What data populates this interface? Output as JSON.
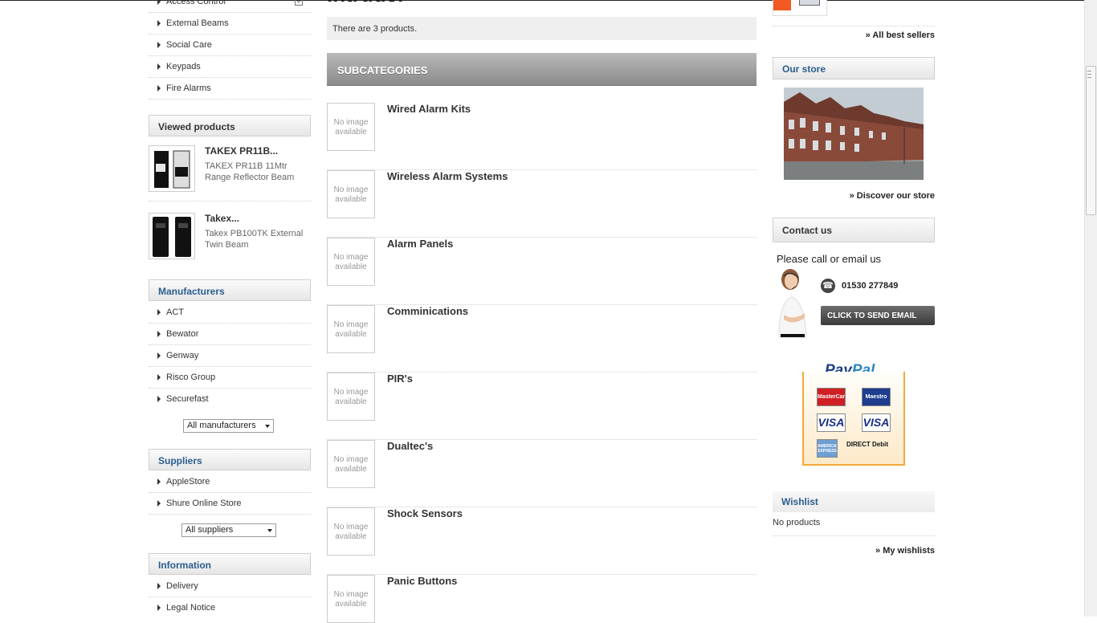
{
  "left": {
    "categories": [
      {
        "label": "Access Control"
      },
      {
        "label": "External Beams"
      },
      {
        "label": "Social Care"
      },
      {
        "label": "Keypads"
      },
      {
        "label": "Fire Alarms"
      }
    ],
    "viewed": {
      "title": "Viewed products",
      "items": [
        {
          "name": "TAKEX PR11B...",
          "desc": "TAKEX PR11B  11Mtr Range Reflector Beam"
        },
        {
          "name": "Takex...",
          "desc": "Takex PB100TK  External Twin Beam"
        }
      ]
    },
    "manufacturers": {
      "title": "Manufacturers",
      "items": [
        "ACT",
        "Bewator",
        "Genway",
        "Risco Group",
        "Securefast"
      ],
      "select_value": "All manufacturers"
    },
    "suppliers": {
      "title": "Suppliers",
      "items": [
        "AppleStore",
        "Shure Online Store"
      ],
      "select_value": "All suppliers"
    },
    "information": {
      "title": "Information",
      "items": [
        "Delivery",
        "Legal Notice"
      ]
    }
  },
  "center": {
    "title_cut": "Intruder",
    "product_count": "There are 3 products.",
    "subcategories_heading": "SUBCATEGORIES",
    "no_image_text": "No image available",
    "subcategories": [
      "Wired Alarm Kits",
      "Wireless Alarm Systems",
      "Alarm Panels",
      "Comminications",
      "PIR's",
      "Dualtec's",
      "Shock Sensors",
      "Panic Buttons"
    ]
  },
  "right": {
    "all_best_sellers": "» All best sellers",
    "store": {
      "title": "Our store",
      "link": "» Discover our store"
    },
    "contact": {
      "title": "Contact us",
      "call_text": "Please call or email us",
      "phone": "01530 277849",
      "email_button": "CLICK TO SEND EMAIL"
    },
    "paypal": {
      "brand1": "Pay",
      "brand2": "Pal",
      "cards": [
        "MasterCard",
        "Maestro",
        "VISA",
        "VISA",
        "AMERICAN EXPRESS",
        "DIRECT Debit"
      ]
    },
    "wishlist": {
      "title": "Wishlist",
      "empty": "No products",
      "link": "» My wishlists"
    }
  },
  "colors": {
    "accent_blue": "#2a5e8f",
    "paypal_orange": "#f4a83a",
    "subcat_header": "#8a8a8a"
  }
}
